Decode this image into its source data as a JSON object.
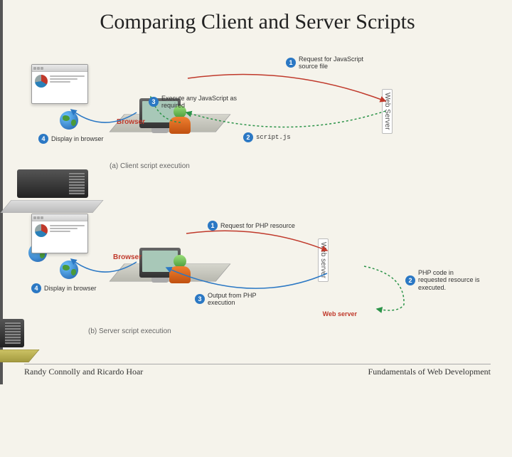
{
  "title": "Comparing Client and Server Scripts",
  "footer": {
    "left": "Randy Connolly and Ricardo Hoar",
    "right": "Fundamentals of Web Development"
  },
  "sectionA": {
    "caption": "(a) Client script execution",
    "browserLabel": "Browser",
    "serverLabel": "Web Server",
    "steps": {
      "s1": "Request for JavaScript source file",
      "s2": "script.js",
      "s3": "Execute any JavaScript as required",
      "s4": "Display in browser"
    }
  },
  "sectionB": {
    "caption": "(b) Server script execution",
    "browserLabel": "Browser",
    "serverLabel": "Web server",
    "steps": {
      "s1": "Request for PHP resource",
      "s2": "PHP code in requested resource is executed.",
      "s3": "Output from PHP execution",
      "s4": "Display in browser"
    }
  }
}
